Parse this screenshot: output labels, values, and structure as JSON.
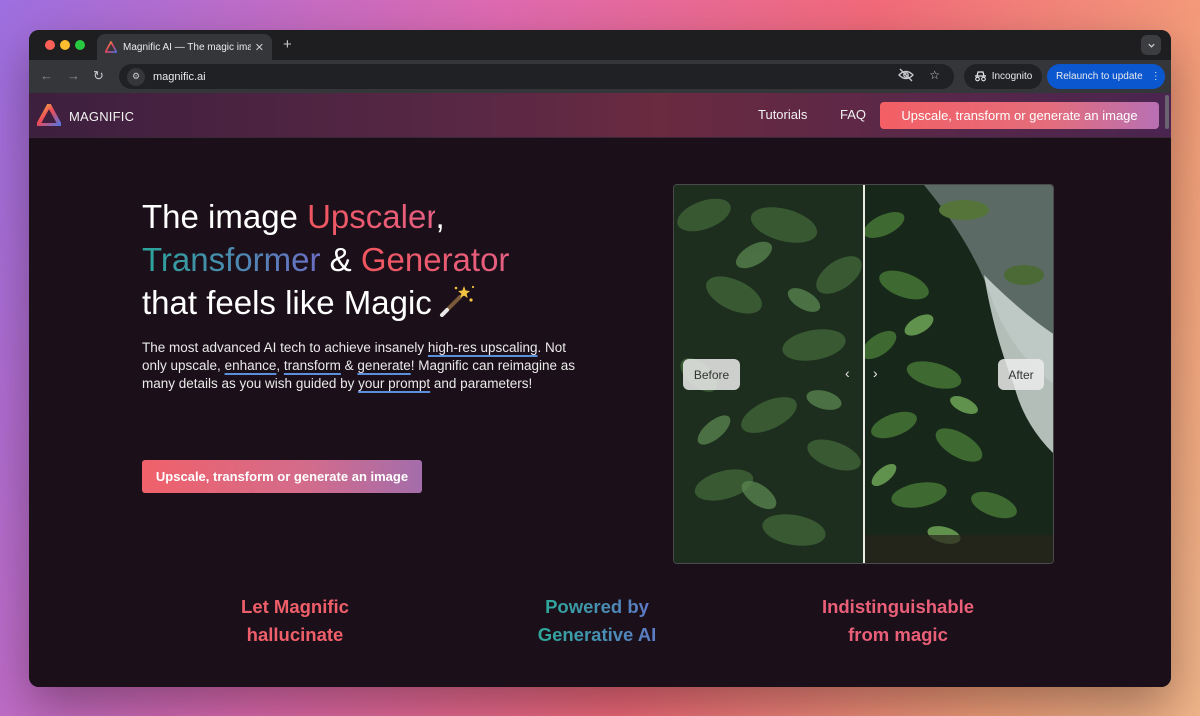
{
  "browser": {
    "tab_title": "Magnific AI — The magic imag",
    "tab_close": "✕",
    "new_tab": "+",
    "url": "magnific.ai",
    "incognito_label": "Incognito",
    "relaunch_label": "Relaunch to update"
  },
  "header": {
    "logo_text": "MAGNIFIC",
    "nav": [
      "Tutorials",
      "FAQ"
    ],
    "cta_label": "Upscale, transform or generate an image"
  },
  "hero": {
    "title_line1_a": "The image ",
    "title_line1_b": "Upscaler",
    "title_line1_c": ",",
    "title_line2_a": "Transformer",
    "title_line2_b": " & ",
    "title_line2_c": "Generator",
    "title_line3": "that feels like Magic",
    "desc_1": "The most advanced AI tech to achieve insanely ",
    "desc_link1": "high-res upscaling",
    "desc_2": ". Not only upscale, ",
    "desc_link2": "enhance",
    "desc_3": ", ",
    "desc_link3": "transform",
    "desc_4": " & ",
    "desc_link4": "generate",
    "desc_5": "! Magnific can reimagine as many details as you wish guided by ",
    "desc_link5": "your prompt",
    "desc_6": " and parameters!",
    "cta_label": "Upscale, transform or generate an image"
  },
  "compare": {
    "before_label": "Before",
    "after_label": "After",
    "arrow_left": "‹",
    "arrow_right": "›"
  },
  "features": [
    {
      "line1": "Let Magnific",
      "line2": "hallucinate"
    },
    {
      "line1": "Powered by",
      "line2": "Generative AI"
    },
    {
      "line1": "Indistinguishable",
      "line2": "from magic"
    }
  ],
  "colors": {
    "accent_red": "#f0565e",
    "accent_teal": "#2aa59a",
    "relaunch_blue": "#0b57d0"
  }
}
